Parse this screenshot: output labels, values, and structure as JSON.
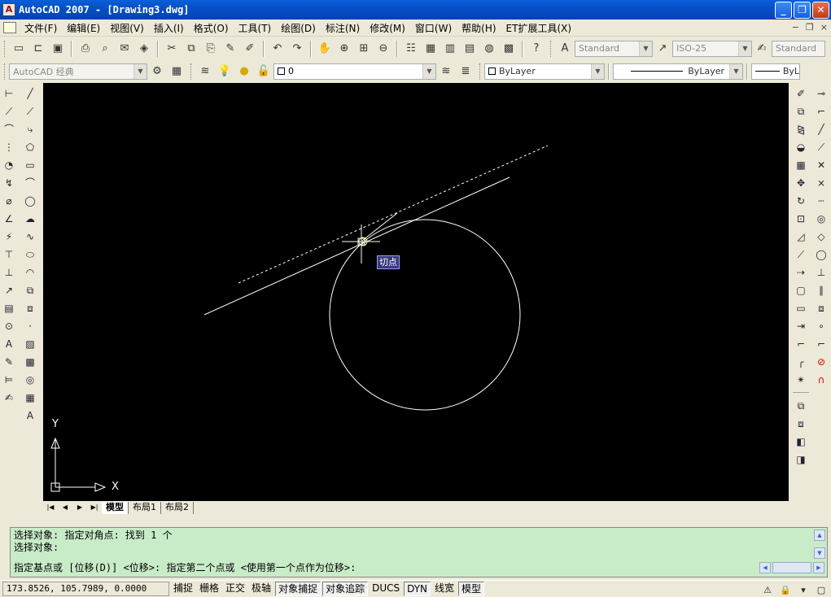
{
  "window": {
    "title": "AutoCAD 2007 - [Drawing3.dwg]",
    "app_icon_text": "A",
    "controls": [
      "_",
      "❐",
      "✕"
    ]
  },
  "menubar": {
    "items": [
      "文件(F)",
      "编辑(E)",
      "视图(V)",
      "插入(I)",
      "格式(O)",
      "工具(T)",
      "绘图(D)",
      "标注(N)",
      "修改(M)",
      "窗口(W)",
      "帮助(H)",
      "ET扩展工具(X)"
    ],
    "mdi_controls": [
      "−",
      "❐",
      "×"
    ]
  },
  "toolbars": {
    "text_style": "Standard",
    "dim_style": "ISO-25",
    "table_style": "Standard",
    "workspace": "AutoCAD 经典",
    "layer": "0",
    "color": "ByLayer",
    "linetype": "ByLayer",
    "lineweight": "ByL"
  },
  "drawing": {
    "snap_tooltip": "切点",
    "ucs_x_label": "X",
    "ucs_y_label": "Y"
  },
  "layout_tabs": [
    "模型",
    "布局1",
    "布局2"
  ],
  "command": {
    "history": [
      "选择对象: 指定对角点: 找到 1 个",
      "选择对象:"
    ],
    "prompt": "指定基点或 [位移(D)] <位移>:  指定第二个点或 <使用第一个点作为位移>:"
  },
  "statusbar": {
    "coords": "173.8526, 105.7989, 0.0000",
    "buttons": [
      {
        "label": "捕捉",
        "on": false
      },
      {
        "label": "栅格",
        "on": false
      },
      {
        "label": "正交",
        "on": false
      },
      {
        "label": "极轴",
        "on": false
      },
      {
        "label": "对象捕捉",
        "on": true
      },
      {
        "label": "对象追踪",
        "on": true
      },
      {
        "label": "DUCS",
        "on": false
      },
      {
        "label": "DYN",
        "on": true
      },
      {
        "label": "线宽",
        "on": false
      },
      {
        "label": "模型",
        "on": true
      }
    ]
  },
  "colors": {
    "titlebar": "#0650c8",
    "canvas": "#000000",
    "command_bg": "#c8ecc8",
    "tooltip_bg": "#3a3a7a"
  }
}
